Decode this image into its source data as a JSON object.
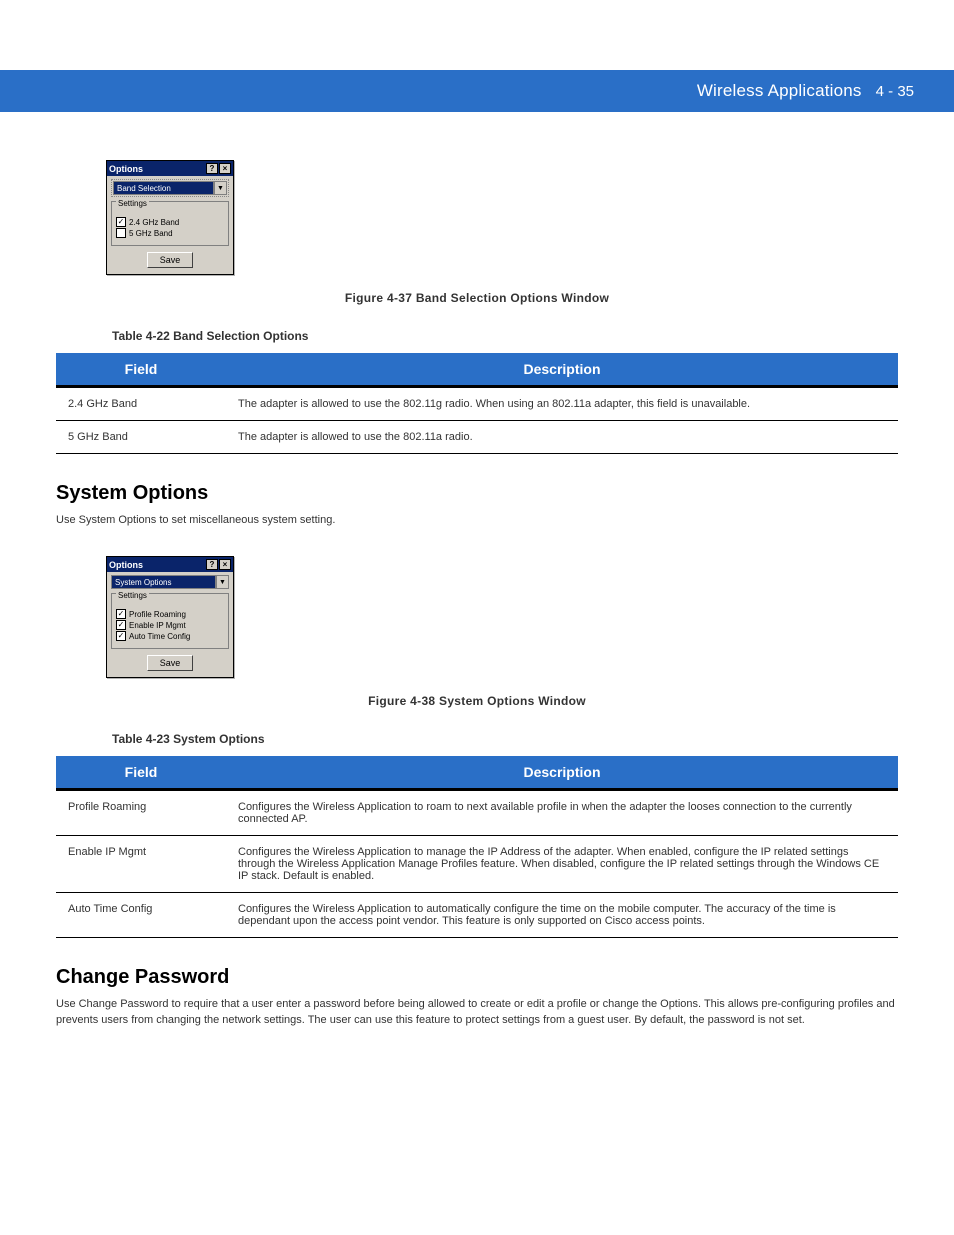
{
  "header": {
    "title": "Wireless Applications",
    "page": "4 - 35"
  },
  "dialog1": {
    "title": "Options",
    "help": "?",
    "close": "×",
    "dropdown": "Band Selection",
    "legend": "Settings",
    "opt1": "2.4 GHz Band",
    "opt2": "5 GHz Band",
    "save": "Save"
  },
  "fig1_caption": "Figure 4-37    Band Selection Options Window",
  "tab1_caption": "Table 4-22    Band Selection Options",
  "table1": {
    "h1": "Field",
    "h2": "Description",
    "r1f": "2.4 GHz Band",
    "r1d": "The adapter is allowed to use the 802.11g radio. When using an 802.11a adapter, this field is unavailable.",
    "r2f": "5 GHz Band",
    "r2d": "The adapter is allowed to use the 802.11a radio."
  },
  "sect_system": "System Options",
  "system_intro": "Use System Options to set miscellaneous system setting.",
  "dialog2": {
    "title": "Options",
    "help": "?",
    "close": "×",
    "dropdown": "System Options",
    "legend": "Settings",
    "opt1": "Profile Roaming",
    "opt2": "Enable IP Mgmt",
    "opt3": "Auto Time Config",
    "save": "Save"
  },
  "fig2_caption": "Figure 4-38    System Options Window",
  "tab2_caption": "Table 4-23    System Options",
  "table2": {
    "h1": "Field",
    "h2": "Description",
    "r1f": "Profile Roaming",
    "r1d": "Configures the Wireless Application to roam to next available profile in when the adapter the looses connection to the currently connected AP.",
    "r2f": "Enable IP Mgmt",
    "r2d": "Configures the Wireless Application to manage the IP Address of the adapter. When enabled, configure the IP related settings through the Wireless Application Manage Profiles feature. When disabled, configure the IP related settings through the Windows CE IP stack. Default is enabled.",
    "r3f": "Auto Time Config",
    "r3d": "Configures the Wireless Application to automatically configure the time on the mobile computer. The accuracy of the time is dependant upon the access point vendor. This feature is only supported on Cisco access points."
  },
  "sect_change": "Change Password",
  "change_intro": "Use Change Password to require that a user enter a password before being allowed to create or edit a profile or change the Options. This allows pre-configuring profiles and prevents users from changing the network settings. The user can use this feature to protect settings from a guest user. By default, the password is not set."
}
